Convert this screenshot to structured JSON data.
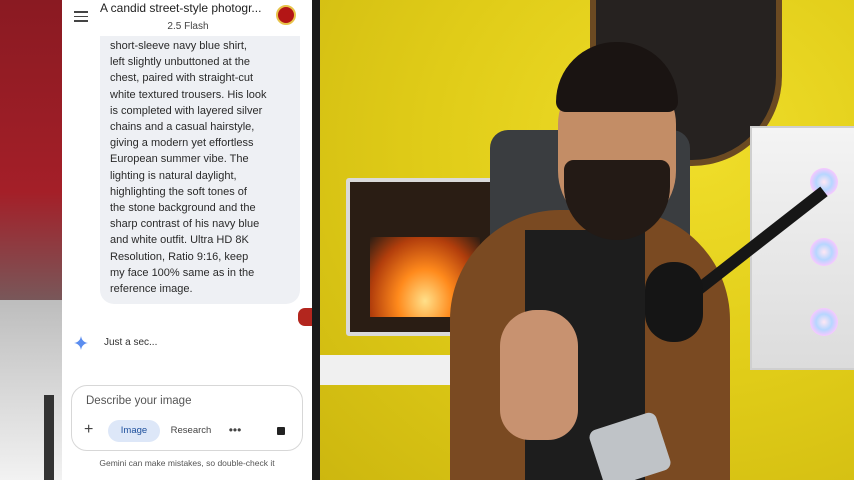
{
  "app": {
    "chat_title": "A candid street-style photogr...",
    "model": "2.5 Flash"
  },
  "conversation": {
    "prompt_text": "short-sleeve navy blue shirt,\nleft slightly unbuttoned at the\nchest, paired with straight-cut\nwhite textured trousers. His look\nis completed with layered silver\nchains and a casual hairstyle,\ngiving a modern yet effortless\nEuropean summer vibe. The\nlighting is natural daylight,\nhighlighting the soft tones of\nthe stone background and the\nsharp contrast of his navy blue\nand white outfit. Ultra HD 8K\nResolution, Ratio 9:16, keep\nmy face 100% same as in the\nreference image.",
    "loading_text": "Just a sec..."
  },
  "composer": {
    "placeholder": "Describe your image",
    "plus_label": "+",
    "image_chip": "Image",
    "research_chip": "Research",
    "more_label": "•••"
  },
  "footer": {
    "disclaimer": "Gemini can make mistakes, so double-check it"
  },
  "colors": {
    "accent": "#1d4f9c",
    "chip_bg": "#dde7f8",
    "bubble_bg": "#eef0f4",
    "record_red": "#b3261e"
  },
  "icons": {
    "menu": "menu-icon",
    "avatar": "avatar",
    "spark": "gemini-spark-icon",
    "plus": "plus-icon",
    "more": "more-icon",
    "stop": "stop-icon"
  }
}
